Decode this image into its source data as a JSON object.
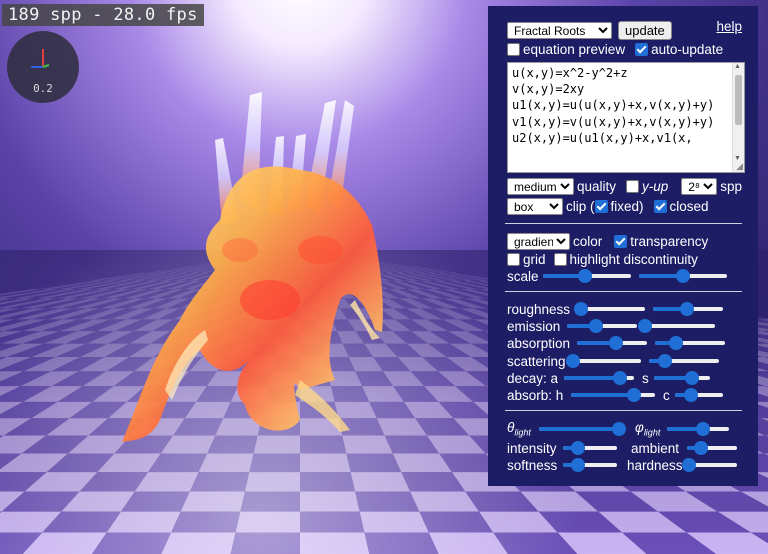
{
  "overlay": {
    "fps_text": "189 spp - 28.0 fps",
    "axis_scale": "0.2"
  },
  "panel": {
    "preset": "Fractal Roots",
    "update_label": "update",
    "help_label": "help",
    "equation_preview_label": "equation preview",
    "equation_preview_checked": false,
    "auto_update_label": "auto-update",
    "auto_update_checked": true,
    "equations": "u(x,y)=x^2-y^2+z\nv(x,y)=2xy\nu1(x,y)=u(u(x,y)+x,v(x,y)+y)\nv1(x,y)=v(u(x,y)+x,v(x,y)+y)\nu2(x,y)=u(u1(x,y)+x,v1(x,",
    "quality_value": "medium",
    "quality_label": "quality",
    "yup_label": "y-up",
    "yup_checked": false,
    "spp_value": "2⁸",
    "spp_label": "spp",
    "clip_value": "box",
    "clip_label": "clip (",
    "fixed_label": "fixed)",
    "fixed_checked": true,
    "closed_label": "closed",
    "closed_checked": true,
    "color_value": "gradient",
    "color_label": "color",
    "transparency_label": "transparency",
    "transparency_checked": true,
    "grid_label": "grid",
    "grid_checked": false,
    "highlight_label": "highlight discontinuity",
    "highlight_checked": false,
    "scale_label": "scale",
    "roughness_label": "roughness",
    "emission_label": "emission",
    "absorption_label": "absorption",
    "scattering_label": "scattering",
    "decay_label": "decay: a",
    "decay_s_label": "s",
    "absorb_label": "absorb: h",
    "absorb_c_label": "c",
    "theta_label": "θ",
    "phi_label": "φ",
    "light_sub": "light",
    "intensity_label": "intensity",
    "ambient_label": "ambient",
    "softness_label": "softness",
    "hardness_label": "hardness"
  },
  "sliders": {
    "scale_a": 0.48,
    "scale_b": 0.5,
    "roughness_a": 0.0,
    "roughness_b": 0.48,
    "emission_a": 0.42,
    "emission_b": 0.0,
    "absorption_a": 0.55,
    "absorption_b": 0.3,
    "scattering_a": 0.0,
    "scattering_b": 0.23,
    "decay_a": 0.8,
    "decay_s": 0.68,
    "absorb_h": 0.75,
    "absorb_c": 0.33,
    "theta": 0.93,
    "phi": 0.58,
    "intensity": 0.27,
    "ambient": 0.27,
    "softness": 0.27,
    "hardness": 0.0
  },
  "colors": {
    "panel_bg": "#1d1d66",
    "accent": "#1f6fd6",
    "floor_light": "#c9b3f2",
    "floor_dark": "#6a4fb8"
  }
}
